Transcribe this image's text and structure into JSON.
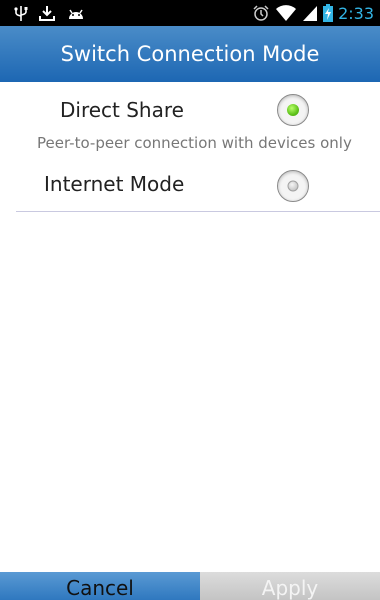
{
  "status_bar": {
    "time": "2:33",
    "icons": [
      "usb-icon",
      "download-icon",
      "android-icon",
      "alarm-icon",
      "wifi-icon",
      "signal-icon",
      "battery-charging-icon"
    ]
  },
  "title": "Switch Connection Mode",
  "options": [
    {
      "label": "Direct Share",
      "description": "Peer-to-peer connection with devices only",
      "selected": true
    },
    {
      "label": "Internet Mode",
      "selected": false
    }
  ],
  "buttons": {
    "cancel": "Cancel",
    "apply": "Apply"
  },
  "colors": {
    "title_bar": "#2a73bb",
    "status_time": "#33b5e5",
    "radio_selected": "#5fc21a"
  }
}
